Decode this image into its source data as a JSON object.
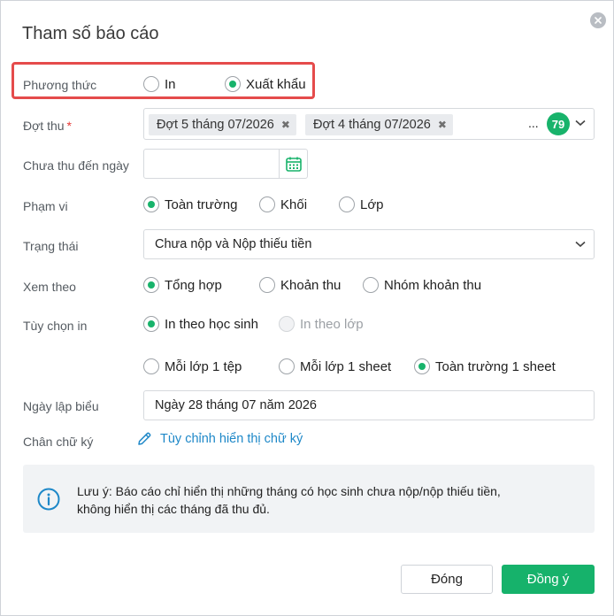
{
  "dialog": {
    "title": "Tham số báo cáo"
  },
  "method": {
    "label": "Phương thức",
    "options": [
      "In",
      "Xuất khẩu"
    ],
    "selected": "Xuất khẩu"
  },
  "period": {
    "label": "Đợt thu",
    "required_mark": "*",
    "tags": [
      "Đợt 5 tháng 07/2026",
      "Đợt 4 tháng 07/2026"
    ],
    "more": "...",
    "count": "79",
    "remove_symbol": "✖"
  },
  "unpaid_date": {
    "label": "Chưa thu đến ngày",
    "value": ""
  },
  "scope": {
    "label": "Phạm vi",
    "options": [
      "Toàn trường",
      "Khối",
      "Lớp"
    ],
    "selected": "Toàn trường"
  },
  "status": {
    "label": "Trạng thái",
    "value": "Chưa nộp và Nộp thiếu tiền"
  },
  "view_by": {
    "label": "Xem theo",
    "options": [
      "Tổng hợp",
      "Khoản thu",
      "Nhóm khoản thu"
    ],
    "selected": "Tổng hợp"
  },
  "print_option": {
    "label": "Tùy chọn in",
    "options": [
      "In theo học sinh",
      "In theo lớp"
    ],
    "selected": "In theo học sinh",
    "disabled": "In theo lớp",
    "file_options": [
      "Mỗi lớp 1 tệp",
      "Mỗi lớp 1 sheet",
      "Toàn trường 1 sheet"
    ],
    "file_selected": "Toàn trường 1 sheet"
  },
  "created_date": {
    "label": "Ngày lập biểu",
    "value": "Ngày 28 tháng 07 năm 2026"
  },
  "signature": {
    "label": "Chân chữ ký",
    "link": "Tùy chỉnh hiển thị chữ ký"
  },
  "note": {
    "line1": "Lưu ý: Báo cáo chỉ hiển thị những tháng có học sinh chưa nộp/nộp thiếu tiền,",
    "line2": "không hiển thị các tháng đã thu đủ."
  },
  "buttons": {
    "close": "Đóng",
    "ok": "Đồng ý"
  },
  "colors": {
    "accent": "#18b36b",
    "highlight": "#e54b4b",
    "link": "#1e88c8"
  }
}
